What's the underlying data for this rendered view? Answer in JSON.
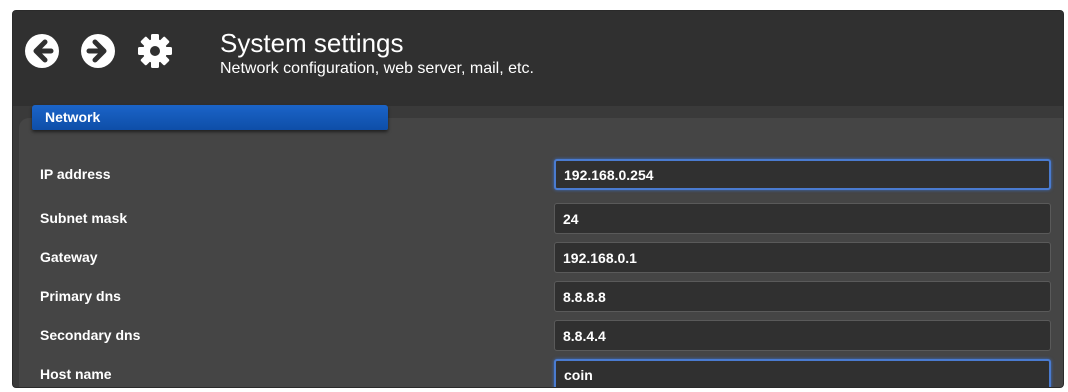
{
  "header": {
    "title": "System settings",
    "subtitle": "Network configuration, web server, mail, etc.",
    "icons": [
      "arrow-left-circle",
      "arrow-right-circle",
      "gear"
    ]
  },
  "tab": {
    "label": "Network"
  },
  "fields": [
    {
      "label": "IP address",
      "value": "192.168.0.254"
    },
    {
      "label": "Subnet mask",
      "value": "24"
    },
    {
      "label": "Gateway",
      "value": "192.168.0.1"
    },
    {
      "label": "Primary dns",
      "value": "8.8.8.8"
    },
    {
      "label": "Secondary dns",
      "value": "8.8.4.4"
    },
    {
      "label": "Host name",
      "value": "coin"
    }
  ],
  "colors": {
    "tab_blue": "#1b64c8",
    "focus_blue": "#4a7bd0",
    "panel": "#454545",
    "header": "#303030"
  }
}
